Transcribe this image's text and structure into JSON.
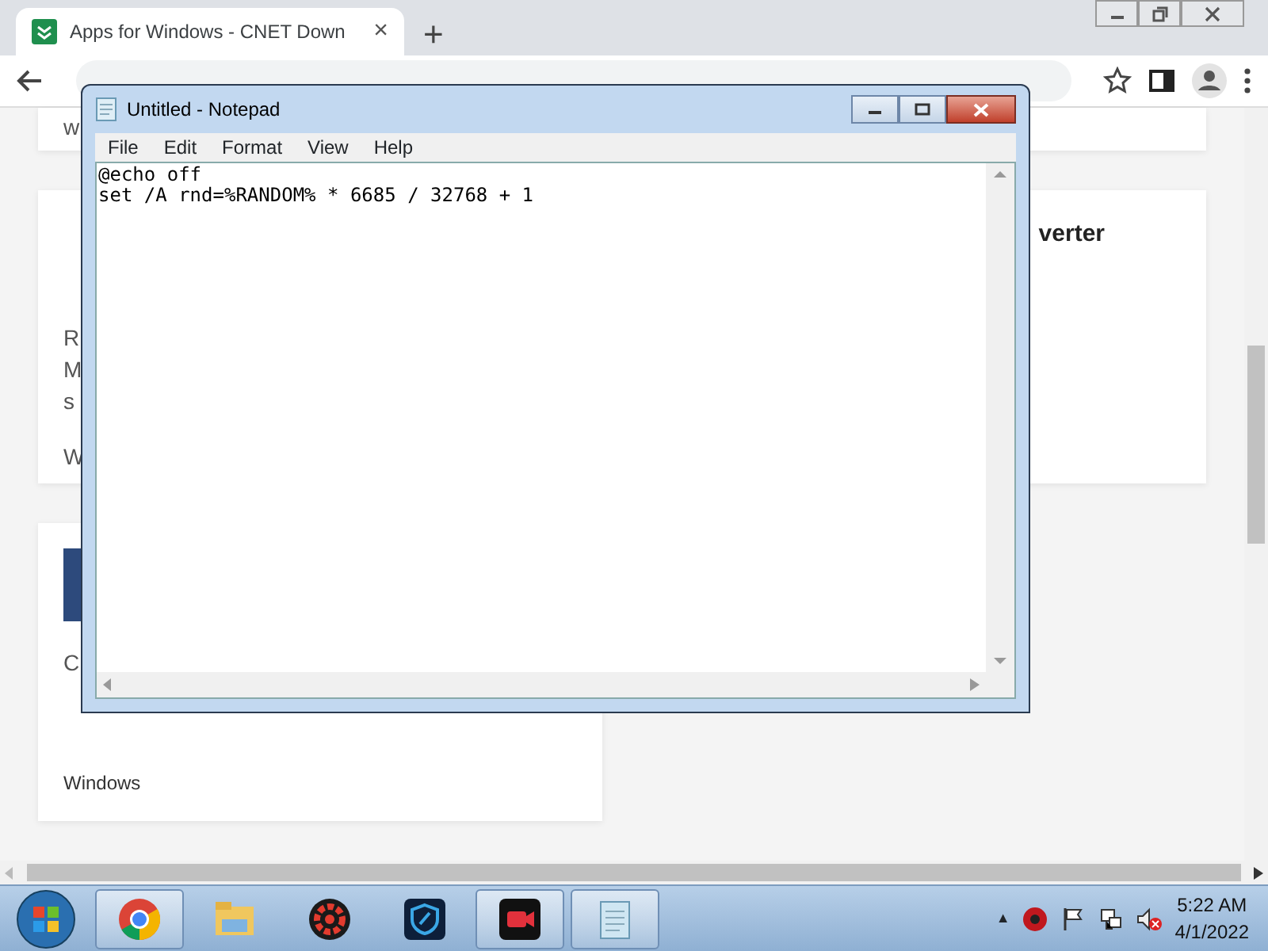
{
  "browser": {
    "tab": {
      "title": "Apps for Windows - CNET Down",
      "close": "×",
      "selected": true
    },
    "new_tab": "+",
    "page_fragments": [
      {
        "kind": "text",
        "text": "w"
      },
      {
        "kind": "heading",
        "text": "verter"
      },
      {
        "kind": "text",
        "text": "R"
      },
      {
        "kind": "text",
        "text": "M"
      },
      {
        "kind": "text",
        "text": "s"
      },
      {
        "kind": "text",
        "text": "W"
      },
      {
        "kind": "text",
        "text": "C"
      },
      {
        "kind": "text",
        "text": "Windows"
      }
    ]
  },
  "notepad": {
    "title": "Untitled - Notepad",
    "menu": [
      "File",
      "Edit",
      "Format",
      "View",
      "Help"
    ],
    "lines": [
      "@echo off",
      "set /A rnd=%RANDOM% * 6685 / 32768 + 1"
    ]
  },
  "taskbar": {
    "apps": [
      {
        "kind": "chrome",
        "running": true
      },
      {
        "kind": "explorer",
        "running": false
      },
      {
        "kind": "driver",
        "running": false
      },
      {
        "kind": "shield",
        "running": false
      },
      {
        "kind": "recorder",
        "running": true
      },
      {
        "kind": "notepad",
        "running": true
      }
    ],
    "tray_arrow": "▲",
    "time": "5:22 AM",
    "date": "4/1/2022"
  }
}
